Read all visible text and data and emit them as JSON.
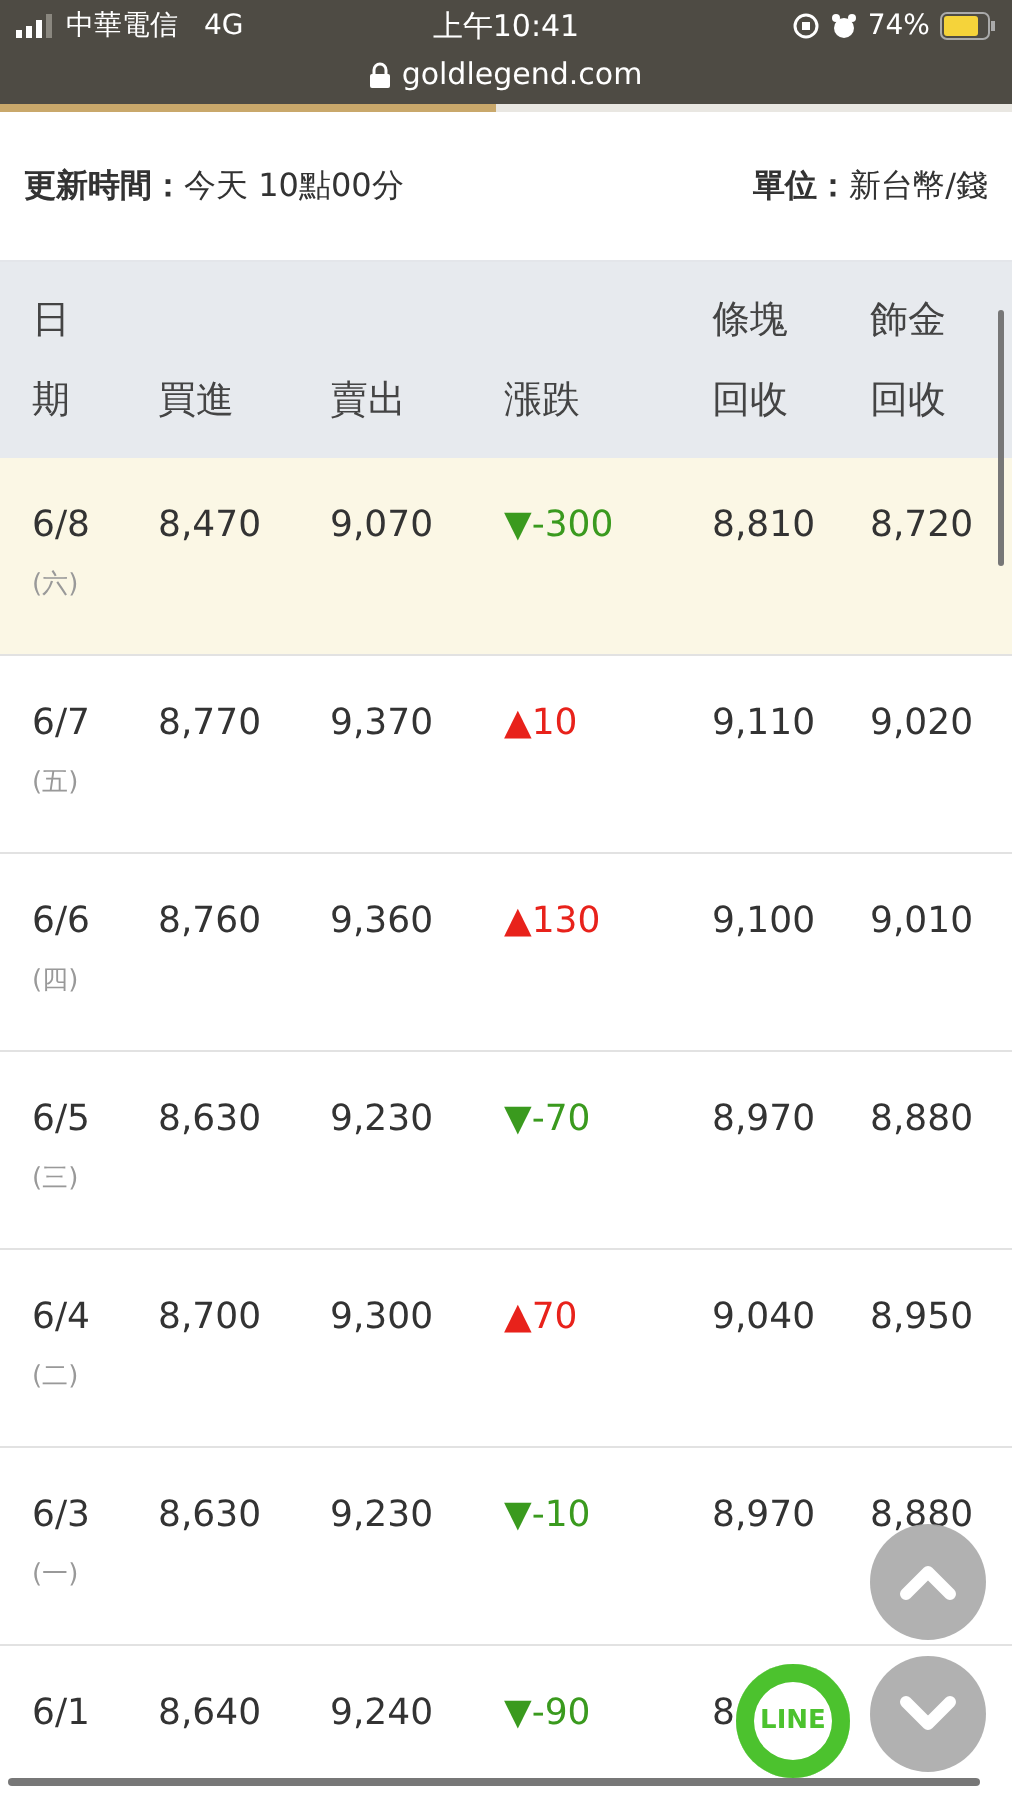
{
  "status_bar": {
    "carrier": "中華電信",
    "network": "4G",
    "time": "上午10:41",
    "battery": "74%",
    "url": "goldlegend.com"
  },
  "loading": {
    "level": 0.49
  },
  "info": {
    "updated_label": "更新時間：",
    "updated_value": "今天 10點00分",
    "unit_label": "單位：",
    "unit_value": "新台幣/錢"
  },
  "table": {
    "columns": [
      [
        "日",
        "期"
      ],
      [
        "買進"
      ],
      [
        "賣出"
      ],
      [
        "漲跌"
      ],
      [
        "條塊",
        "回收"
      ],
      [
        "飾金",
        "回收"
      ]
    ],
    "rows": [
      {
        "date": "6/8",
        "day": "(六)",
        "buy": "8,470",
        "sell": "9,070",
        "change": "▼-300",
        "color": "#3a9a1e",
        "bullion": "8,810",
        "jewelry": "8,720",
        "highlighted": true
      },
      {
        "date": "6/7",
        "day": "(五)",
        "buy": "8,770",
        "sell": "9,370",
        "change": "▲10",
        "color": "#e8221b",
        "bullion": "9,110",
        "jewelry": "9,020",
        "highlighted": false
      },
      {
        "date": "6/6",
        "day": "(四)",
        "buy": "8,760",
        "sell": "9,360",
        "change": "▲130",
        "color": "#e8221b",
        "bullion": "9,100",
        "jewelry": "9,010",
        "highlighted": false
      },
      {
        "date": "6/5",
        "day": "(三)",
        "buy": "8,630",
        "sell": "9,230",
        "change": "▼-70",
        "color": "#3a9a1e",
        "bullion": "8,970",
        "jewelry": "8,880",
        "highlighted": false
      },
      {
        "date": "6/4",
        "day": "(二)",
        "buy": "8,700",
        "sell": "9,300",
        "change": "▲70",
        "color": "#e8221b",
        "bullion": "9,040",
        "jewelry": "8,950",
        "highlighted": false
      },
      {
        "date": "6/3",
        "day": "(一)",
        "buy": "8,630",
        "sell": "9,230",
        "change": "▼-10",
        "color": "#3a9a1e",
        "bullion": "8,970",
        "jewelry": "8,880",
        "highlighted": false
      },
      {
        "date": "6/1",
        "buy": "8,640",
        "sell": "9,240",
        "change": "▼-90",
        "color": "#3a9a1e",
        "bullion": "8",
        "highlighted": false
      }
    ]
  },
  "line_button": {
    "label": "LINE"
  }
}
